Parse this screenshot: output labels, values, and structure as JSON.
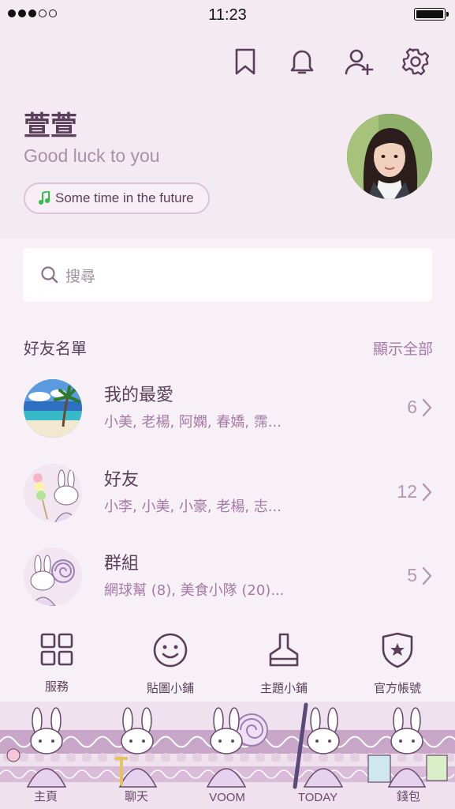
{
  "status_bar": {
    "time": "11:23"
  },
  "header": {
    "icons": [
      "bookmark-icon",
      "bell-icon",
      "add-friend-icon",
      "settings-icon"
    ],
    "profile_name": "萱萱",
    "status_message": "Good luck to you",
    "music": "Some time in the future"
  },
  "search": {
    "placeholder": "搜尋"
  },
  "friends_section": {
    "title": "好友名單",
    "show_all": "顯示全部",
    "rows": [
      {
        "title": "我的最愛",
        "subtitle": "小美, 老楊, 阿嫻, 春嬌, 霈...",
        "count": "6"
      },
      {
        "title": "好友",
        "subtitle": "小李, 小美, 小豪, 老楊, 志...",
        "count": "12"
      },
      {
        "title": "群組",
        "subtitle": "網球幫 (8), 美食小隊 (20)...",
        "count": "5"
      }
    ]
  },
  "services": [
    {
      "label": "服務",
      "icon": "grid-icon"
    },
    {
      "label": "貼圖小鋪",
      "icon": "smiley-icon"
    },
    {
      "label": "主題小鋪",
      "icon": "brush-icon"
    },
    {
      "label": "官方帳號",
      "icon": "shield-star-icon"
    }
  ],
  "tabs": [
    {
      "label": "主頁"
    },
    {
      "label": "聊天"
    },
    {
      "label": "VOOM"
    },
    {
      "label": "TODAY"
    },
    {
      "label": "錢包"
    }
  ],
  "colors": {
    "accent": "#5b3f5a",
    "muted": "#a67aa6",
    "background": "#f7f0f6",
    "header_bg": "#f4eaf2"
  }
}
